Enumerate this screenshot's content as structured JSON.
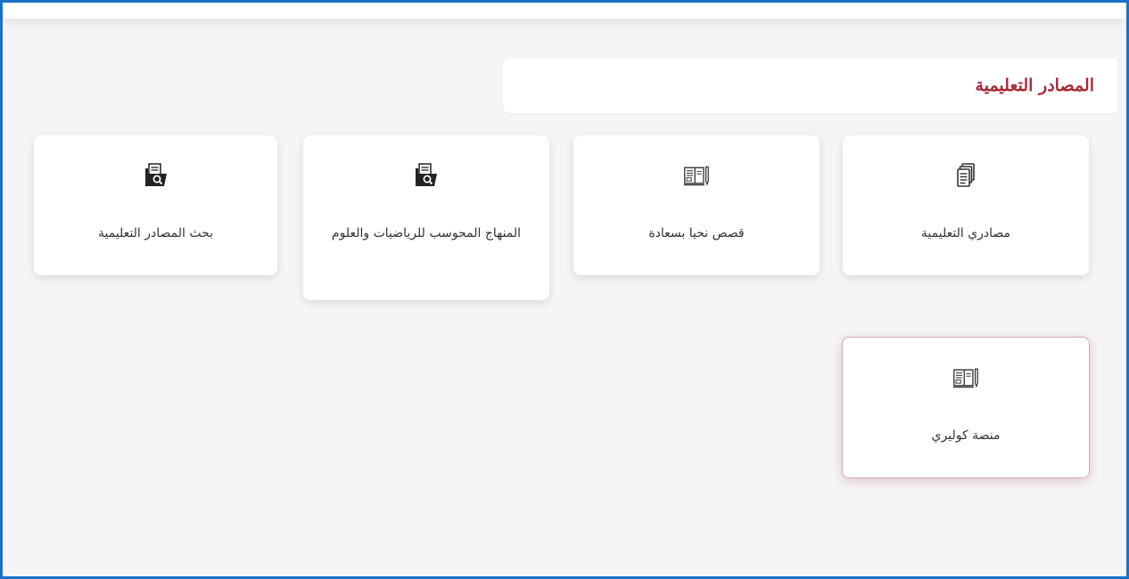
{
  "section": {
    "title": "المصادر التعليمية"
  },
  "cards": [
    {
      "label": "مصادري التعليمية",
      "icon": "documents-stack-icon"
    },
    {
      "label": "قصص نحيا بسعادة",
      "icon": "book-pencil-icon"
    },
    {
      "label": "المنهاج المحوسب للرياضيات والعلوم",
      "icon": "folder-search-icon"
    },
    {
      "label": "بحث المصادر التعليمية",
      "icon": "folder-search-icon"
    },
    {
      "label": "منصة كوليري",
      "icon": "book-pencil-icon",
      "state": "selected"
    }
  ],
  "colors": {
    "frame_border": "#1a72c7",
    "title": "#a92a3a",
    "page_background": "#f5f5f5",
    "card_background": "#ffffff"
  }
}
